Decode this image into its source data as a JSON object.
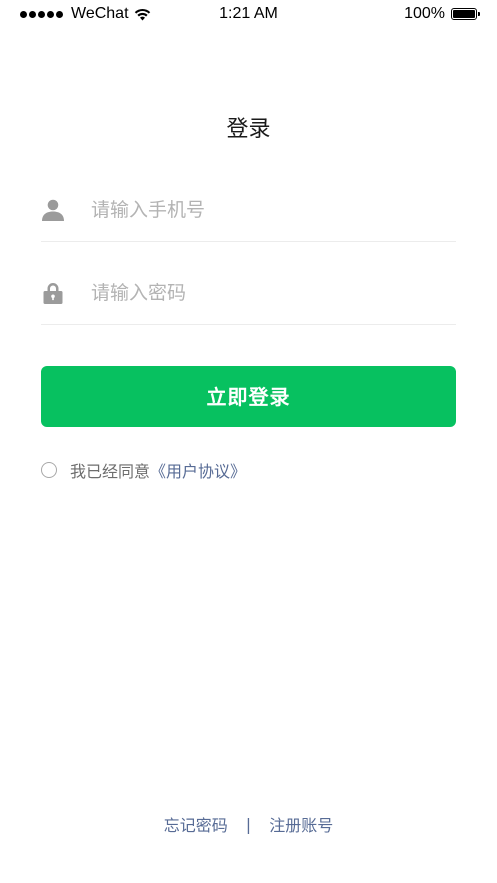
{
  "status_bar": {
    "carrier": "WeChat",
    "time": "1:21 AM",
    "battery": "100%",
    "signal_icon": "signal-dots-icon",
    "wifi_icon": "wifi-icon",
    "battery_icon": "battery-icon",
    "battery_level": 1.0
  },
  "page": {
    "title": "登录"
  },
  "form": {
    "phone": {
      "icon": "user-icon",
      "placeholder": "请输入手机号",
      "value": ""
    },
    "password": {
      "icon": "lock-icon",
      "placeholder": "请输入密码",
      "value": ""
    }
  },
  "login_button": {
    "label": "立即登录"
  },
  "agreement": {
    "checked": false,
    "text": "我已经同意",
    "link_text": "《用户协议》"
  },
  "footer": {
    "forgot_password": "忘记密码",
    "separator": "|",
    "register": "注册账号"
  },
  "colors": {
    "primary_green": "#07c160",
    "link_blue": "#576b95",
    "placeholder_gray": "#b3b3b3",
    "icon_gray": "#9b9b9b",
    "divider": "#ececec"
  }
}
